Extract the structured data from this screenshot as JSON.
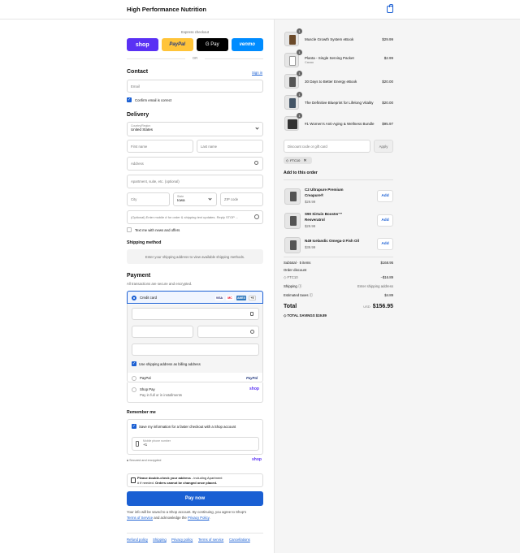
{
  "header": {
    "store_name": "High Performance Nutrition",
    "cart_icon": "shopping-bag-icon"
  },
  "express": {
    "label": "Express checkout",
    "buttons": [
      {
        "label": "shop",
        "color": "#5a31f4"
      },
      {
        "label": "PayPal",
        "color": "#ffc439"
      },
      {
        "label": "G Pay",
        "color": "#000000"
      },
      {
        "label": "venmo",
        "color": "#008cff"
      }
    ],
    "or_label": "OR"
  },
  "contact": {
    "title": "Contact",
    "sign_in": "Sign in",
    "email_placeholder": "Email",
    "confirm_label": "Confirm email is correct"
  },
  "delivery": {
    "title": "Delivery",
    "country_label": "Country/Region",
    "country_value": "United States",
    "first_name": "First name",
    "last_name": "Last name",
    "address": "Address",
    "apartment": "Apartment, suite, etc. (optional)",
    "city": "City",
    "state_label": "State",
    "state_value": "Iowa",
    "zip": "ZIP code",
    "phone": "(Optional) Enter mobile # for order & shipping text updates. Reply STOP ...",
    "text_me": "Text me with news and offers"
  },
  "shipping": {
    "title": "Shipping method",
    "placeholder": "Enter your shipping address to view available shipping methods."
  },
  "payment": {
    "title": "Payment",
    "subtitle": "All transactions are secure and encrypted.",
    "credit_card": "Credit card",
    "card_brands": [
      "VISA",
      "MC",
      "AMEX",
      "+5"
    ],
    "billing_label": "Use shipping address as billing address",
    "paypal": "PayPal",
    "paypal_logo": "PayPal",
    "shop_pay": "Shop Pay",
    "shop_pay_sub": "Pay in full or in installments",
    "shop_logo": "shop"
  },
  "remember": {
    "title": "Remember me",
    "save_label": "Save my information for a faster checkout with a Shop account",
    "phone_label": "Mobile phone number",
    "phone_value": "+1",
    "secure": "Secured and encrypted",
    "shop_logo": "shop"
  },
  "notice": {
    "bold1": "Please double-check your address",
    "text1": " - including Apartment",
    "text2": "# if needed. ",
    "bold2": "Orders cannot be changed once placed."
  },
  "pay_now": "Pay now",
  "legal": {
    "line1": "Your info will be saved to a Shop account. By continuing, you agree to Shop's",
    "terms": "Terms of Service",
    "and": " and acknowledge the ",
    "privacy": "Privacy Policy",
    "dot": "."
  },
  "footer": [
    "Refund policy",
    "Shipping",
    "Privacy policy",
    "Terms of service",
    "Cancellations"
  ],
  "cart": {
    "items": [
      {
        "qty": "1",
        "name": "Muscle Growth System eBook",
        "sub": "",
        "price": "$29.99"
      },
      {
        "qty": "1",
        "name": "Planta - Single Serving Packet",
        "sub": "Cacao",
        "price": "$2.99"
      },
      {
        "qty": "1",
        "name": "30 Days to Better Energy eBook",
        "sub": "",
        "price": "$20.00"
      },
      {
        "qty": "1",
        "name": "The Definitive Blueprint for Lifelong Vitality",
        "sub": "",
        "price": "$20.00"
      },
      {
        "qty": "1",
        "name": "#1 Women's Anti-Aging & Wellness Bundle",
        "sub": "",
        "price": "$95.97"
      }
    ],
    "discount_placeholder": "Discount code or gift card",
    "apply": "Apply",
    "code": "FTC10",
    "add_title": "Add to this order",
    "upsells": [
      {
        "name1": "C2 Ultrapure Premium",
        "name2": "Creapure®",
        "price": "$29.99",
        "add": "Add"
      },
      {
        "name1": "S90 Sirtuin Booster™",
        "name2": "Resveratrol",
        "price": "$29.99",
        "add": "Add"
      },
      {
        "name1": "N49 Icelandic Omega-3 Fish Oil",
        "name2": "",
        "price": "$39.99",
        "add": "Add"
      }
    ],
    "subtotal_label": "Subtotal · 5 items",
    "subtotal": "$168.95",
    "order_discount": "Order discount",
    "discount_code": "FTC10",
    "discount_value": "−$16.89",
    "shipping_label": "Shipping",
    "shipping_value": "Enter shipping address",
    "taxes_label": "Estimated taxes",
    "taxes_value": "$4.89",
    "total_label": "Total",
    "currency": "USD",
    "total": "$156.95",
    "savings_label": "TOTAL SAVINGS",
    "savings": "$19.89"
  }
}
